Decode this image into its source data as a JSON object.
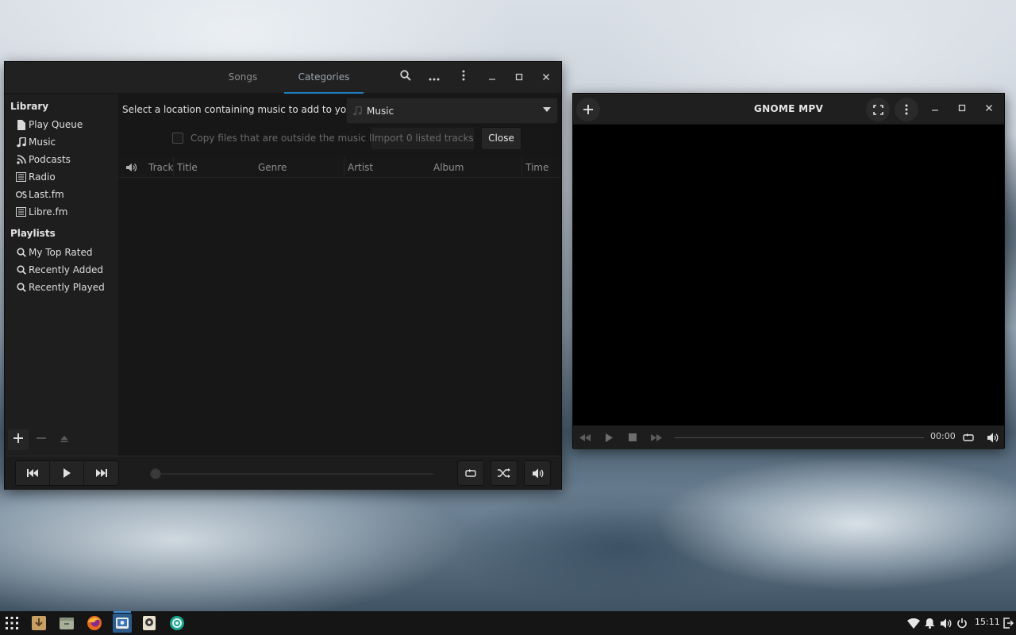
{
  "rhythmbox": {
    "tabs": [
      "Songs",
      "Categories"
    ],
    "sidebar": {
      "library_heading": "Library",
      "library_items": [
        {
          "label": "Play Queue",
          "icon": "document-icon"
        },
        {
          "label": "Music",
          "icon": "music-note-icon"
        },
        {
          "label": "Podcasts",
          "icon": "rss-icon"
        },
        {
          "label": "Radio",
          "icon": "radio-icon"
        },
        {
          "label": "Last.fm",
          "icon": "lastfm-icon"
        },
        {
          "label": "Libre.fm",
          "icon": "radio-icon"
        }
      ],
      "playlists_heading": "Playlists",
      "playlist_items": [
        {
          "label": "My Top Rated",
          "icon": "search-icon"
        },
        {
          "label": "Recently Added",
          "icon": "search-icon"
        },
        {
          "label": "Recently Played",
          "icon": "search-icon"
        }
      ]
    },
    "import": {
      "location_label": "Select a location containing music to add to your library:",
      "location_value": "Music",
      "copy_label": "Copy files that are outside the music library",
      "import_button": "Import 0 listed tracks",
      "close_button": "Close"
    },
    "columns": [
      "Track",
      "Title",
      "Genre",
      "Artist",
      "Album",
      "Time"
    ]
  },
  "mpv": {
    "title": "GNOME MPV",
    "time": "00:00"
  },
  "taskbar": {
    "clock": "15:11"
  }
}
